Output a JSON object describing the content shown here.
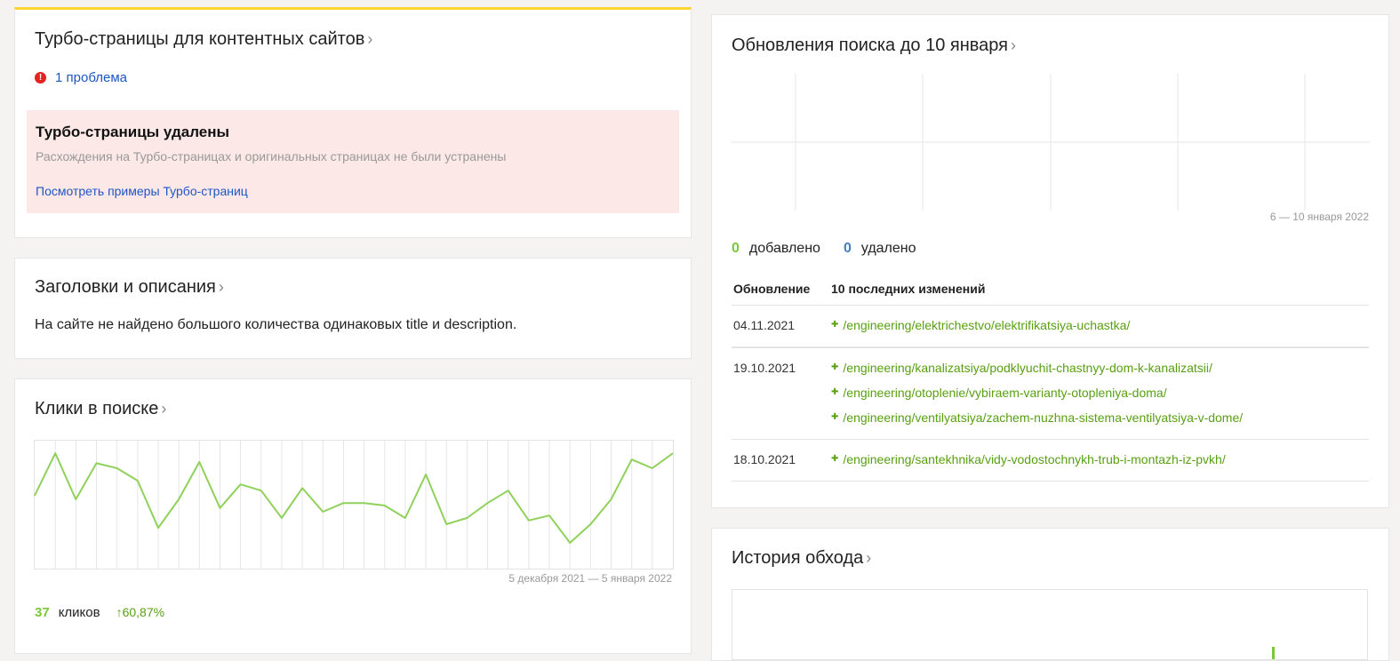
{
  "turbo": {
    "title": "Турбо-страницы для контентных сайтов",
    "problem_link": "1 проблема",
    "alert_title": "Турбо-страницы удалены",
    "alert_text": "Расхождения на Турбо-страницах и оригинальных страницах не были устранены",
    "alert_link": "Посмотреть примеры Турбо-страниц",
    "accent_color": "#fcd535",
    "alert_bg": "#fde8e8"
  },
  "headings": {
    "title": "Заголовки и описания",
    "text": "На сайте не найдено большого количества одинаковых title и description."
  },
  "clicks": {
    "title": "Клики в поиске",
    "date_range": "5 декабря 2021 — 5 января 2022",
    "count": "37",
    "count_label": "кликов",
    "change": "↑60,87%",
    "chart_data": {
      "type": "line",
      "title": "",
      "xlabel": "",
      "ylabel": "",
      "ylim": [
        0,
        100
      ],
      "grid": true,
      "series": [
        {
          "values": [
            58,
            92,
            55,
            84,
            80,
            70,
            32,
            55,
            85,
            48,
            67,
            62,
            40,
            64,
            45,
            52,
            52,
            50,
            40,
            75,
            35,
            40,
            52,
            62,
            38,
            42,
            20,
            35,
            55,
            87,
            80,
            92
          ]
        }
      ]
    }
  },
  "search_updates": {
    "title": "Обновления поиска до 10 января",
    "date_range": "6 — 10 января 2022",
    "added_count": "0",
    "added_label": "добавлено",
    "removed_count": "0",
    "removed_label": "удалено",
    "col_update": "Обновление",
    "col_changes": "10 последних изменений",
    "rows": [
      {
        "date": "04.11.2021",
        "changes": [
          "/engineering/elektrichestvo/elektrifikatsiya-uchastka/"
        ]
      },
      {
        "date": "19.10.2021",
        "changes": [
          "/engineering/kanalizatsiya/podklyuchit-chastnyy-dom-k-kanalizatsii/",
          "/engineering/otoplenie/vybiraem-varianty-otopleniya-doma/",
          "/engineering/ventilyatsiya/zachem-nuzhna-sistema-ventilyatsiya-v-dome/"
        ]
      },
      {
        "date": "18.10.2021",
        "changes": [
          "/engineering/santekhnika/vidy-vodostochnykh-trub-i-montazh-iz-pvkh/"
        ]
      }
    ]
  },
  "crawl_history": {
    "title": "История обхода"
  },
  "icons": {
    "problem": "exclamation-icon",
    "chevron": "chevron-right-icon",
    "plus": "plus-icon"
  },
  "colors": {
    "line": "#8fd15a",
    "green_text": "#58a011",
    "link": "#1f55c5",
    "added": "#79c936",
    "removed": "#3f7fc4"
  }
}
